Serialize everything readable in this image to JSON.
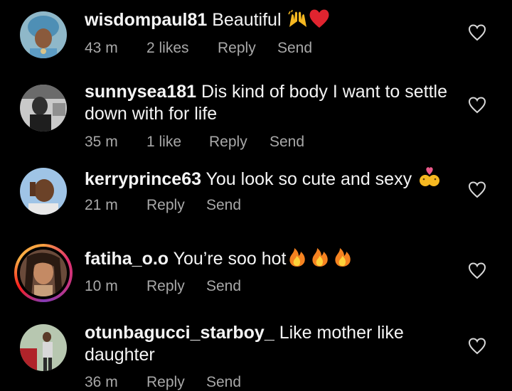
{
  "comments": [
    {
      "username": "wisdompaul81",
      "text": "Beautiful",
      "emojis": [
        "raising-hands-emoji",
        "red-heart-emoji"
      ],
      "time": "43 m",
      "likes": "2 likes",
      "reply_label": "Reply",
      "send_label": "Send"
    },
    {
      "username": "sunnysea181",
      "text": "Dis kind of body I want to settle down with for life",
      "emojis": [],
      "time": "35 m",
      "likes": "1 like",
      "reply_label": "Reply",
      "send_label": "Send"
    },
    {
      "username": "kerryprince63",
      "text": "You look so cute and sexy",
      "emojis": [
        "kiss-emoji"
      ],
      "time": "21 m",
      "likes": "",
      "reply_label": "Reply",
      "send_label": "Send"
    },
    {
      "username": "fatiha_o.o",
      "text": "You’re soo hot",
      "emojis": [
        "fire-emoji",
        "fire-emoji",
        "fire-emoji"
      ],
      "time": "10 m",
      "likes": "",
      "reply_label": "Reply",
      "send_label": "Send",
      "has_story_ring": true
    },
    {
      "username": "otunbagucci_starboy_",
      "text": "Like mother like daughter",
      "emojis": [],
      "time": "36 m",
      "likes": "",
      "reply_label": "Reply",
      "send_label": "Send"
    }
  ],
  "colors": {
    "background": "#000000",
    "text": "#f5f5f5",
    "meta": "#a8a8a8",
    "heart_outline": "#d8d8d8"
  }
}
